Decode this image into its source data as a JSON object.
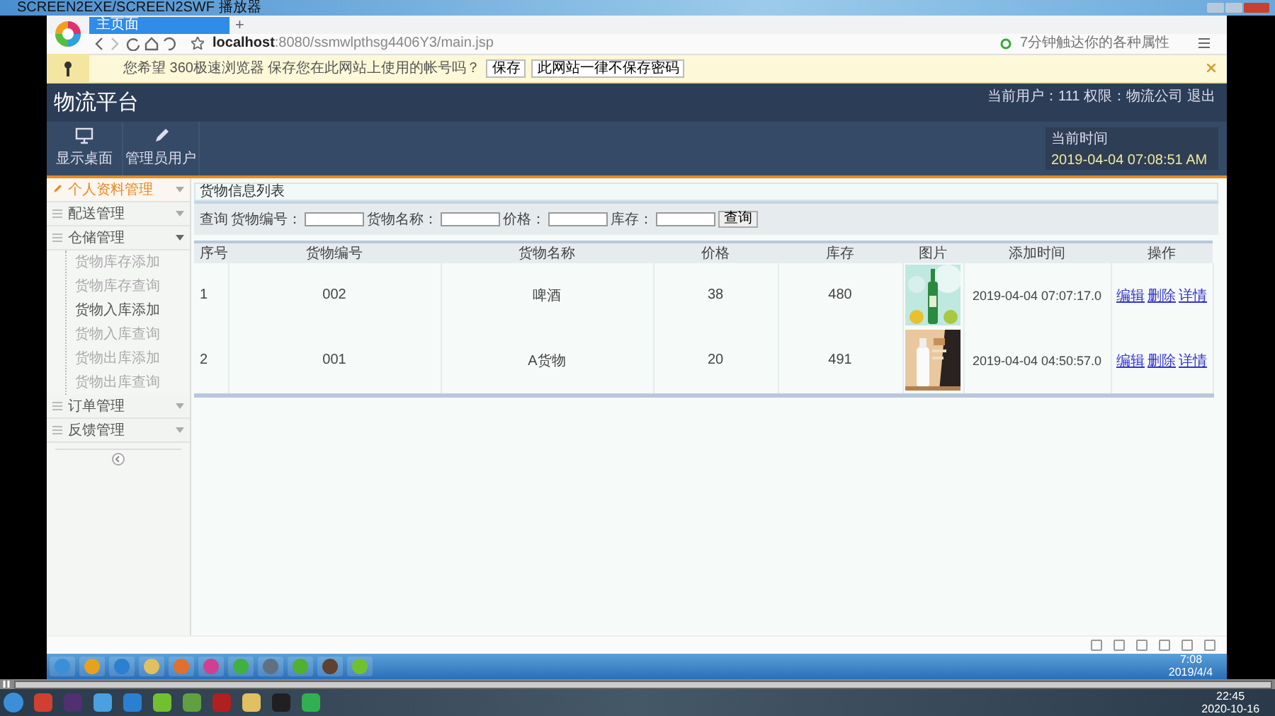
{
  "player": {
    "title": "SCREEN2EXE/SCREEN2SWF 播放器"
  },
  "browser": {
    "tab": {
      "title": "主页面"
    },
    "new_tab": "+",
    "url_host": "localhost",
    "url_rest": ":8080/ssmwlpthsg4406Y3/main.jsp",
    "search": {
      "placeholder": "7分钟触达你的各种属性"
    },
    "password_bar": {
      "message": "您希望 360极速浏览器 保存您在此网站上使用的帐号吗？",
      "buttons": [
        "保存",
        "此网站一律不保存密码"
      ]
    }
  },
  "app": {
    "title": "物流平台",
    "user_info": "当前用户：111 权限：物流公司",
    "logout": "退出",
    "toolbar": [
      {
        "label": "显示桌面",
        "kind": "monitor"
      },
      {
        "label": "管理员用户",
        "kind": "pencil"
      }
    ],
    "clock": {
      "label": "当前时间",
      "value": "2019-04-04 07:08:51 AM"
    }
  },
  "sidebar": {
    "items": [
      {
        "label": "个人资料管理",
        "selected": true,
        "expanded": false
      },
      {
        "label": "配送管理",
        "selected": false,
        "expanded": false
      },
      {
        "label": "仓储管理",
        "selected": false,
        "expanded": true,
        "children": [
          {
            "label": "货物库存添加",
            "selected": false
          },
          {
            "label": "货物库存查询",
            "selected": false
          },
          {
            "label": "货物入库添加",
            "selected": true
          },
          {
            "label": "货物入库查询",
            "selected": false
          },
          {
            "label": "货物出库添加",
            "selected": false
          },
          {
            "label": "货物出库查询",
            "selected": false
          }
        ]
      },
      {
        "label": "订单管理",
        "selected": false,
        "expanded": false
      },
      {
        "label": "反馈管理",
        "selected": false,
        "expanded": false
      }
    ]
  },
  "main": {
    "title": "货物信息列表",
    "search": {
      "label": "查询",
      "fields": [
        {
          "label": "货物编号："
        },
        {
          "label": "货物名称："
        },
        {
          "label": "价格："
        },
        {
          "label": "库存："
        }
      ],
      "button": "查询"
    },
    "table": {
      "columns": [
        "序号",
        "货物编号",
        "货物名称",
        "价格",
        "库存",
        "图片",
        "添加时间",
        "操作"
      ],
      "rows": [
        {
          "index": "1",
          "code": "002",
          "name": "啤酒",
          "price": "38",
          "stock": "480",
          "picture": {
            "kind": "picture"
          },
          "added": "2019-04-04 07:07:17.0",
          "actions": [
            "编辑",
            "删除",
            "详情"
          ]
        },
        {
          "index": "2",
          "code": "001",
          "name": "A货物",
          "price": "20",
          "stock": "491",
          "picture": {
            "kind": "picture"
          },
          "added": "2019-04-04 04:50:57.0",
          "actions": [
            "编辑",
            "删除",
            "详情"
          ]
        }
      ]
    }
  },
  "desktop": {
    "clock": {
      "time": "7:08",
      "date": "2019/4/4"
    }
  },
  "host": {
    "clock": {
      "time": "22:45",
      "date": "2020-10-16"
    }
  }
}
